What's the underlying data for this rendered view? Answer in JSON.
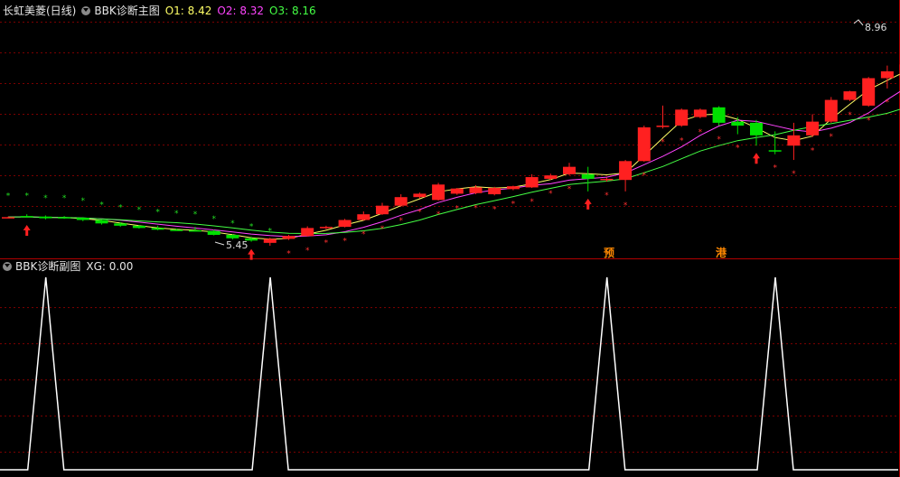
{
  "main_panel": {
    "stock_title": "长虹美菱(日线)",
    "indicator_name": "BBK诊断主图",
    "o1_label": "O1: 8.42",
    "o2_label": "O2: 8.32",
    "o3_label": "O3: 8.16",
    "high_label": "8.96",
    "low_label": "5.45",
    "marker_yu": "预",
    "marker_gang": "港"
  },
  "sub_panel": {
    "indicator_name": "BBK诊断副图",
    "xg_label": "XG: 0.00"
  },
  "colors": {
    "up": "#ff2020",
    "down": "#00e000",
    "o1": "#ffff66",
    "o2": "#ff44ff",
    "o3": "#44ff44",
    "grid": "#7a0000",
    "signal_line": "#ffffff"
  },
  "chart_data": [
    {
      "type": "candlestick",
      "title": "BBK诊断主图",
      "series_names": [
        "O1",
        "O2",
        "O3"
      ],
      "ohlc": [
        [
          5.95,
          5.96,
          5.93,
          5.95
        ],
        [
          5.97,
          6.0,
          5.94,
          5.96
        ],
        [
          5.96,
          5.98,
          5.91,
          5.93
        ],
        [
          5.95,
          5.97,
          5.92,
          5.94
        ],
        [
          5.94,
          5.95,
          5.88,
          5.9
        ],
        [
          5.9,
          5.91,
          5.82,
          5.84
        ],
        [
          5.84,
          5.86,
          5.78,
          5.8
        ],
        [
          5.8,
          5.81,
          5.75,
          5.76
        ],
        [
          5.76,
          5.8,
          5.72,
          5.73
        ],
        [
          5.73,
          5.75,
          5.71,
          5.72
        ],
        [
          5.72,
          5.78,
          5.7,
          5.71
        ],
        [
          5.71,
          5.73,
          5.63,
          5.64
        ],
        [
          5.64,
          5.65,
          5.56,
          5.58
        ],
        [
          5.58,
          5.61,
          5.52,
          5.54
        ],
        [
          5.5,
          5.59,
          5.45,
          5.57
        ],
        [
          5.57,
          5.64,
          5.55,
          5.62
        ],
        [
          5.62,
          5.79,
          5.61,
          5.76
        ],
        [
          5.76,
          5.8,
          5.74,
          5.78
        ],
        [
          5.78,
          5.92,
          5.77,
          5.9
        ],
        [
          5.9,
          6.05,
          5.89,
          6.0
        ],
        [
          6.0,
          6.2,
          5.99,
          6.15
        ],
        [
          6.15,
          6.35,
          6.13,
          6.3
        ],
        [
          6.3,
          6.38,
          6.28,
          6.36
        ],
        [
          6.25,
          6.55,
          6.24,
          6.52
        ],
        [
          6.36,
          6.46,
          6.34,
          6.45
        ],
        [
          6.37,
          6.51,
          6.35,
          6.47
        ],
        [
          6.35,
          6.48,
          6.33,
          6.46
        ],
        [
          6.44,
          6.5,
          6.42,
          6.49
        ],
        [
          6.47,
          6.7,
          6.46,
          6.65
        ],
        [
          6.62,
          6.71,
          6.6,
          6.68
        ],
        [
          6.7,
          6.9,
          6.68,
          6.83
        ],
        [
          6.7,
          6.83,
          6.4,
          6.62
        ],
        [
          6.6,
          6.64,
          6.57,
          6.62
        ],
        [
          6.6,
          6.95,
          6.4,
          6.93
        ],
        [
          6.93,
          7.55,
          6.92,
          7.52
        ],
        [
          7.53,
          7.9,
          7.5,
          7.55
        ],
        [
          7.55,
          7.85,
          7.53,
          7.83
        ],
        [
          7.7,
          7.85,
          7.68,
          7.83
        ],
        [
          7.87,
          7.89,
          7.55,
          7.6
        ],
        [
          7.62,
          7.7,
          7.4,
          7.55
        ],
        [
          7.6,
          7.65,
          7.2,
          7.38
        ],
        [
          7.12,
          7.45,
          7.05,
          7.1
        ],
        [
          7.2,
          7.6,
          6.95,
          7.38
        ],
        [
          7.38,
          7.75,
          7.35,
          7.62
        ],
        [
          7.62,
          8.05,
          7.6,
          8.0
        ],
        [
          8.0,
          8.16,
          7.98,
          8.15
        ],
        [
          7.9,
          8.4,
          7.88,
          8.38
        ],
        [
          8.38,
          8.6,
          8.2,
          8.5
        ],
        [
          8.4,
          8.96,
          8.38,
          8.62
        ],
        [
          8.23,
          8.33,
          8.18,
          8.28
        ]
      ]
    },
    {
      "type": "line",
      "title": "BBK诊断副图",
      "series_names": [
        "XG"
      ],
      "signal_bars": [
        1,
        13,
        31,
        40
      ]
    }
  ]
}
